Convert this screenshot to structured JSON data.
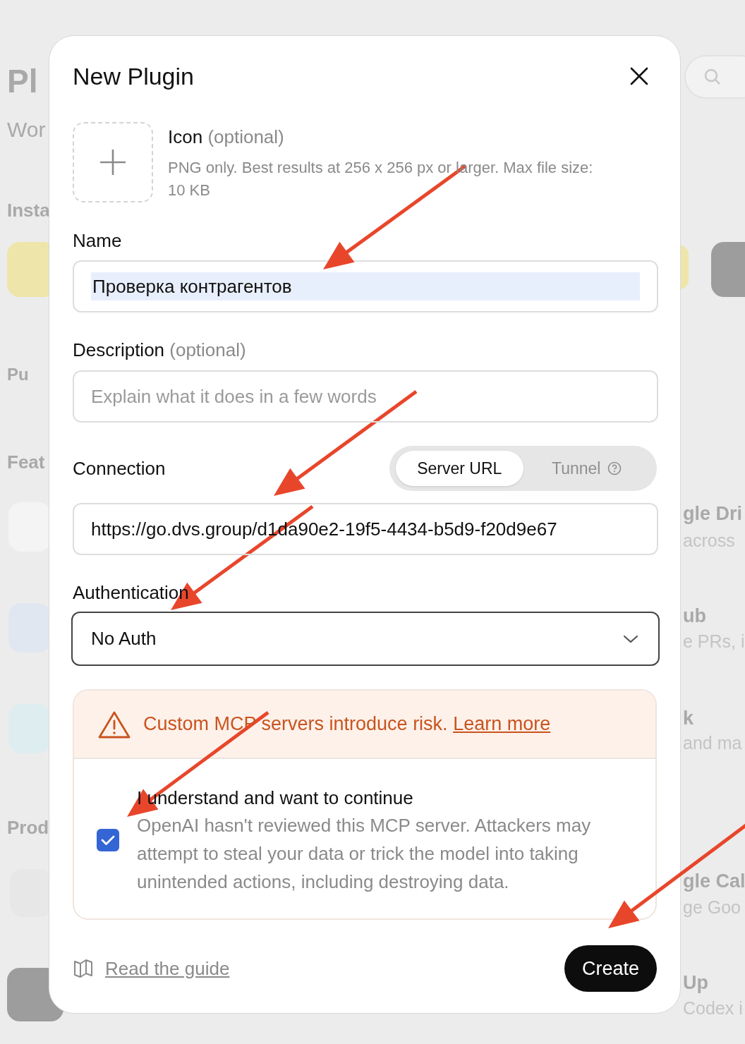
{
  "background": {
    "left_texts": [
      "Pl",
      "Wor",
      "Insta",
      "Pu",
      "Feat",
      "Prod"
    ],
    "right_texts": [
      "gle Dri",
      "across",
      "ub",
      "e PRs, i",
      "k",
      "and ma",
      "gle Cal",
      "ge Goo",
      "Up",
      "Codex i"
    ]
  },
  "dialog": {
    "title": "New Plugin",
    "icon_upload": {
      "label": "Icon",
      "optional": "(optional)",
      "hint": "PNG only. Best results at 256 x 256 px or larger. Max file size: 10 KB"
    },
    "name": {
      "label": "Name",
      "value": "Проверка контрагентов",
      "text_highlighted": true
    },
    "description": {
      "label": "Description",
      "optional": "(optional)",
      "placeholder": "Explain what it does in a few words"
    },
    "connection": {
      "label": "Connection",
      "options": [
        {
          "label": "Server URL",
          "selected": true,
          "help": false
        },
        {
          "label": "Tunnel",
          "selected": false,
          "help": true
        }
      ],
      "value": "https://go.dvs.group/d1da90e2-19f5-4434-b5d9-f20d9e67"
    },
    "authentication": {
      "label": "Authentication",
      "value": "No Auth"
    },
    "warning": {
      "text": "Custom MCP servers introduce risk.",
      "link": "Learn more"
    },
    "consent": {
      "checked": true,
      "title": "I understand and want to continue",
      "description": "OpenAI hasn't reviewed this MCP server. Attackers may attempt to steal your data or trick the model into taking unintended actions, including destroying data."
    },
    "footer": {
      "guide_link": "Read the guide",
      "create_button": "Create"
    }
  }
}
